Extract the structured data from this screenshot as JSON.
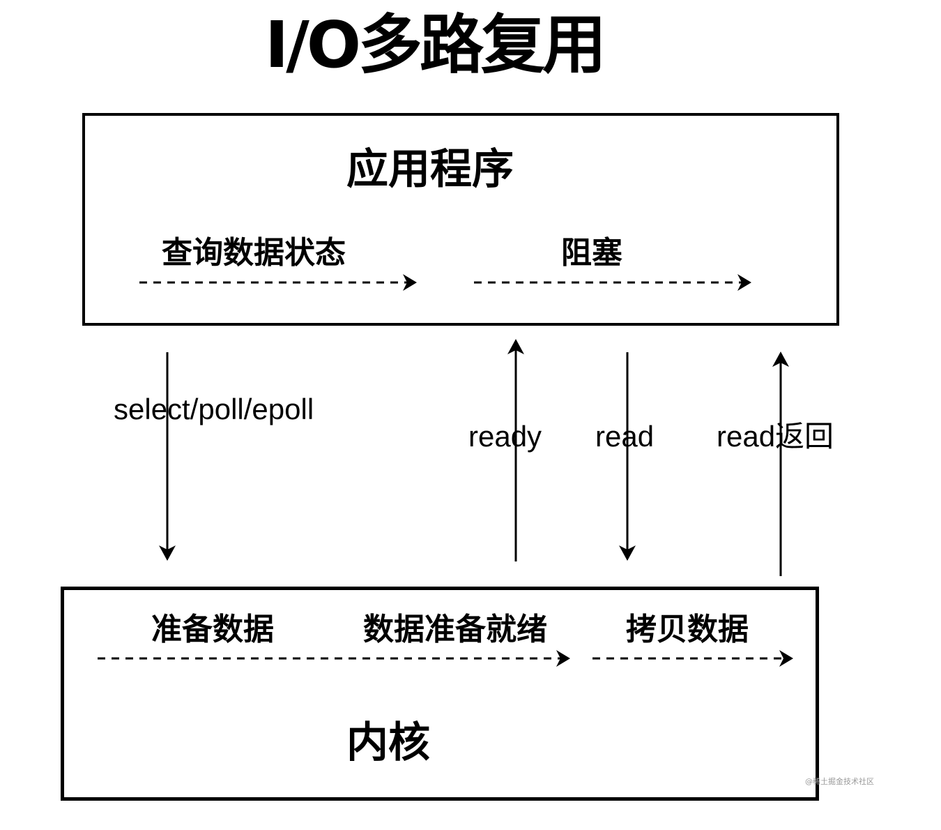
{
  "title": "I/O多路复用",
  "application": {
    "label": "应用程序",
    "stages": [
      {
        "label": "查询数据状态"
      },
      {
        "label": "阻塞"
      }
    ]
  },
  "kernel": {
    "label": "内核",
    "stages": [
      {
        "label": "准备数据"
      },
      {
        "label": "数据准备就绪"
      },
      {
        "label": "拷贝数据"
      }
    ]
  },
  "calls": [
    {
      "label": "select/poll/epoll",
      "direction": "down"
    },
    {
      "label": "ready",
      "direction": "up"
    },
    {
      "label": "read",
      "direction": "down"
    },
    {
      "label": "read返回",
      "direction": "up"
    }
  ],
  "watermark": "@稀土掘金技术社区",
  "colors": {
    "line": "#000000",
    "background": "#ffffff"
  }
}
